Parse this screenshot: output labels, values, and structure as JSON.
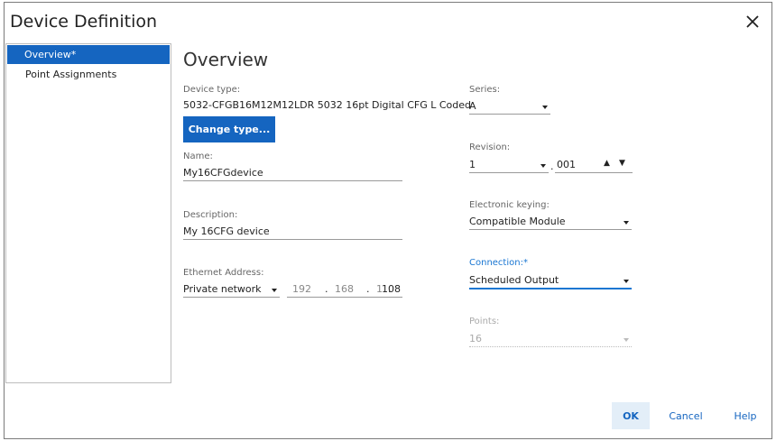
{
  "dialog": {
    "title": "Device Definition",
    "close_icon": "close-icon"
  },
  "sidebar": {
    "items": [
      {
        "label": "Overview*",
        "selected": true
      },
      {
        "label": "Point Assignments",
        "selected": false
      }
    ]
  },
  "main": {
    "heading": "Overview",
    "device_type": {
      "label": "Device type:",
      "value": "5032-CFGB16M12M12LDR 5032 16pt Digital CFG L Coded"
    },
    "change_type_button": "Change type...",
    "name": {
      "label": "Name:",
      "value": "My16CFGdevice"
    },
    "description": {
      "label": "Description:",
      "value": "My 16CFG device"
    },
    "ethernet": {
      "label": "Ethernet Address:",
      "network": "Private network",
      "ip": [
        "192",
        "168",
        "1",
        "108"
      ]
    },
    "series": {
      "label": "Series:",
      "value": "A"
    },
    "revision": {
      "label": "Revision:",
      "major": "1",
      "minor": "001"
    },
    "keying": {
      "label": "Electronic keying:",
      "value": "Compatible Module"
    },
    "connection": {
      "label": "Connection:*",
      "value": "Scheduled Output"
    },
    "points": {
      "label": "Points:",
      "value": "16"
    }
  },
  "footer": {
    "ok": "OK",
    "cancel": "Cancel",
    "help": "Help"
  },
  "colors": {
    "accent": "#1565c0",
    "link": "#1976d2"
  }
}
